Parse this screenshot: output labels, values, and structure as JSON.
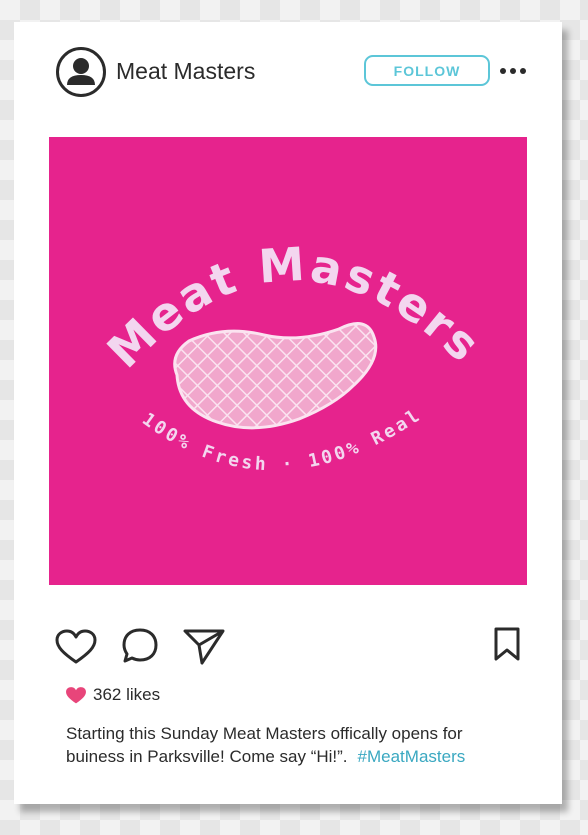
{
  "post": {
    "username": "Meat Masters",
    "follow_label": "FOLLOW",
    "image": {
      "brand_text": "Meat Masters",
      "tagline": "100% Fresh · 100% Real",
      "background_color": "#e6238d"
    },
    "icons": {
      "avatar": "user-avatar-icon",
      "more": "more-options-icon",
      "like": "heart-icon",
      "comment": "comment-icon",
      "share": "share-icon",
      "save": "bookmark-icon",
      "liked": "filled-heart-icon"
    },
    "likes_label": "362 likes",
    "caption": {
      "text": "Starting this Sunday Meat Masters offically opens for buiness in Parksville! Come say “Hi!”.",
      "hashtag": "#MeatMasters"
    }
  },
  "colors": {
    "accent": "#5cc6d8",
    "hashtag": "#3aa8c1",
    "like_heart": "#e8457a",
    "image_bg": "#e6238d"
  }
}
